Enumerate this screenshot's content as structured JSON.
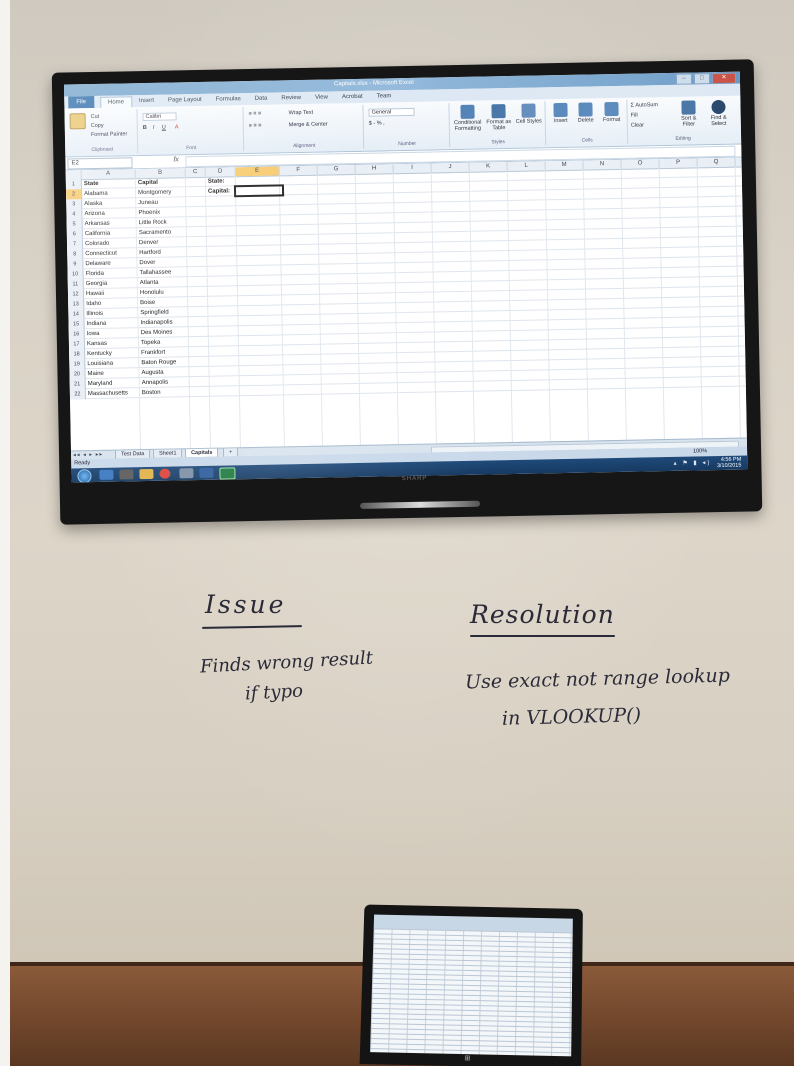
{
  "excel": {
    "window_title": "Capitals.xlsx - Microsoft Excel",
    "tabs": [
      "File",
      "Home",
      "Insert",
      "Page Layout",
      "Formulas",
      "Data",
      "Review",
      "View",
      "Acrobat",
      "Team"
    ],
    "ribbon": {
      "cut": "Cut",
      "copy": "Copy",
      "format_painter": "Format Painter",
      "clipboard": "Clipboard",
      "font_name": "Calibri",
      "font_group": "Font",
      "wrap_text": "Wrap Text",
      "merge_center": "Merge & Center",
      "alignment": "Alignment",
      "number_format": "General",
      "number_symbols": "$ - % ,",
      "number": "Number",
      "conditional_formatting": "Conditional Formatting",
      "format_as_table": "Format as Table",
      "cell_styles": "Cell Styles",
      "styles": "Styles",
      "insert": "Insert",
      "delete": "Delete",
      "format": "Format",
      "cells": "Cells",
      "autosum": "AutoSum",
      "fill": "Fill",
      "clear": "Clear",
      "sort_filter": "Sort & Filter",
      "find_select": "Find & Select",
      "editing": "Editing"
    },
    "name_box": "E2",
    "fx": "fx",
    "columns": [
      "A",
      "B",
      "C",
      "D",
      "E",
      "F",
      "G",
      "H",
      "I",
      "J",
      "K",
      "L",
      "M",
      "N",
      "O",
      "P",
      "Q"
    ],
    "lookup": {
      "state_label": "State:",
      "capital_label": "Capital:",
      "state_value": "",
      "capital_value": ""
    },
    "rows": [
      {
        "n": "1",
        "state": "State",
        "capital": "Capital"
      },
      {
        "n": "2",
        "state": "Alabama",
        "capital": "Montgomery"
      },
      {
        "n": "3",
        "state": "Alaska",
        "capital": "Juneau"
      },
      {
        "n": "4",
        "state": "Arizona",
        "capital": "Phoenix"
      },
      {
        "n": "5",
        "state": "Arkansas",
        "capital": "Little Rock"
      },
      {
        "n": "6",
        "state": "California",
        "capital": "Sacramento"
      },
      {
        "n": "7",
        "state": "Colorado",
        "capital": "Denver"
      },
      {
        "n": "8",
        "state": "Connecticut",
        "capital": "Hartford"
      },
      {
        "n": "9",
        "state": "Delaware",
        "capital": "Dover"
      },
      {
        "n": "10",
        "state": "Florida",
        "capital": "Tallahassee"
      },
      {
        "n": "11",
        "state": "Georgia",
        "capital": "Atlanta"
      },
      {
        "n": "12",
        "state": "Hawaii",
        "capital": "Honolulu"
      },
      {
        "n": "13",
        "state": "Idaho",
        "capital": "Boise"
      },
      {
        "n": "14",
        "state": "Illinois",
        "capital": "Springfield"
      },
      {
        "n": "15",
        "state": "Indiana",
        "capital": "Indianapolis"
      },
      {
        "n": "16",
        "state": "Iowa",
        "capital": "Des Moines"
      },
      {
        "n": "17",
        "state": "Kansas",
        "capital": "Topeka"
      },
      {
        "n": "18",
        "state": "Kentucky",
        "capital": "Frankfort"
      },
      {
        "n": "19",
        "state": "Louisiana",
        "capital": "Baton Rouge"
      },
      {
        "n": "20",
        "state": "Maine",
        "capital": "Augusta"
      },
      {
        "n": "21",
        "state": "Maryland",
        "capital": "Annapolis"
      },
      {
        "n": "22",
        "state": "Massachusetts",
        "capital": "Boston"
      }
    ],
    "sheet_tabs": [
      "Test Data",
      "Sheet1",
      "Capitals"
    ],
    "active_sheet": "Capitals",
    "status": "Ready",
    "zoom": "100%",
    "clock_time": "4:56 PM",
    "clock_date": "3/10/2015",
    "tv_brand": "SHARP"
  },
  "whiteboard": {
    "issue_heading": "Issue",
    "issue_line1": "Finds wrong result",
    "issue_line2": "if typo",
    "resolution_heading": "Resolution",
    "resolution_line1": "Use exact not range lookup",
    "resolution_line2": "in VLOOKUP()"
  },
  "colors": {
    "wall": "#d9d2c6",
    "desk": "#6f452b",
    "marker": "#2a2a38",
    "excel_selected_header": "#f7c96a",
    "excel_file_tab": "#2b6aa8"
  }
}
